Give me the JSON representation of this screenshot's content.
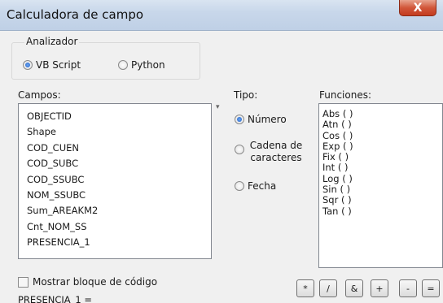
{
  "window": {
    "title": "Calculadora de campo",
    "close_label": "X"
  },
  "analyzer": {
    "label": "Analizador",
    "options": [
      {
        "label": "VB Script",
        "selected": true
      },
      {
        "label": "Python",
        "selected": false
      }
    ]
  },
  "fields": {
    "label": "Campos:",
    "items": [
      "OBJECTID",
      "Shape",
      "COD_CUEN",
      "COD_SUBC",
      "COD_SSUBC",
      "NOM_SSUBC",
      "Sum_AREAKM2",
      "Cnt_NOM_SS",
      "PRESENCIA_1"
    ]
  },
  "type": {
    "label": "Tipo:",
    "options": [
      {
        "label": "Número",
        "selected": true
      },
      {
        "label": "Cadena de caracteres",
        "selected": false
      },
      {
        "label": "Fecha",
        "selected": false
      }
    ]
  },
  "functions": {
    "label": "Funciones:",
    "items": [
      "Abs ( )",
      "Atn ( )",
      "Cos ( )",
      "Exp ( )",
      "Fix ( )",
      "Int ( )",
      "Log ( )",
      "Sin ( )",
      "Sqr ( )",
      "Tan ( )"
    ]
  },
  "code_block": {
    "label": "Mostrar bloque de código",
    "checked": false
  },
  "operators": [
    "*",
    "/",
    "&",
    "+",
    "-",
    "="
  ],
  "expression": "PRESENCIA_1 =",
  "misc": {
    "separator_mark": "▾"
  },
  "colors": {
    "accent": "#1d5ec9",
    "close": "#c33b1f",
    "titlebar": "#c8d7ea"
  }
}
